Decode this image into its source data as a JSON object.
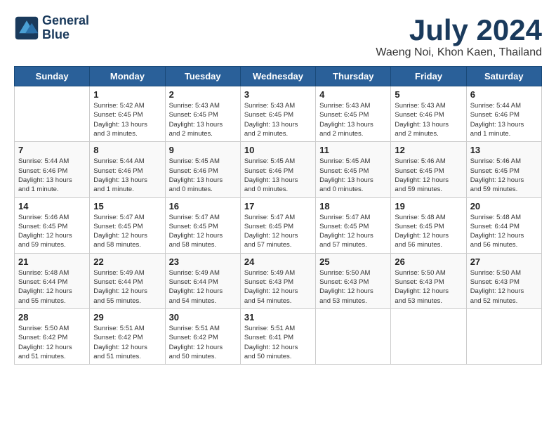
{
  "header": {
    "logo_line1": "General",
    "logo_line2": "Blue",
    "month_year": "July 2024",
    "location": "Waeng Noi, Khon Kaen, Thailand"
  },
  "weekdays": [
    "Sunday",
    "Monday",
    "Tuesday",
    "Wednesday",
    "Thursday",
    "Friday",
    "Saturday"
  ],
  "weeks": [
    [
      {
        "day": "",
        "info": ""
      },
      {
        "day": "1",
        "info": "Sunrise: 5:42 AM\nSunset: 6:45 PM\nDaylight: 13 hours\nand 3 minutes."
      },
      {
        "day": "2",
        "info": "Sunrise: 5:43 AM\nSunset: 6:45 PM\nDaylight: 13 hours\nand 2 minutes."
      },
      {
        "day": "3",
        "info": "Sunrise: 5:43 AM\nSunset: 6:45 PM\nDaylight: 13 hours\nand 2 minutes."
      },
      {
        "day": "4",
        "info": "Sunrise: 5:43 AM\nSunset: 6:45 PM\nDaylight: 13 hours\nand 2 minutes."
      },
      {
        "day": "5",
        "info": "Sunrise: 5:43 AM\nSunset: 6:46 PM\nDaylight: 13 hours\nand 2 minutes."
      },
      {
        "day": "6",
        "info": "Sunrise: 5:44 AM\nSunset: 6:46 PM\nDaylight: 13 hours\nand 1 minute."
      }
    ],
    [
      {
        "day": "7",
        "info": "Sunrise: 5:44 AM\nSunset: 6:46 PM\nDaylight: 13 hours\nand 1 minute."
      },
      {
        "day": "8",
        "info": "Sunrise: 5:44 AM\nSunset: 6:46 PM\nDaylight: 13 hours\nand 1 minute."
      },
      {
        "day": "9",
        "info": "Sunrise: 5:45 AM\nSunset: 6:46 PM\nDaylight: 13 hours\nand 0 minutes."
      },
      {
        "day": "10",
        "info": "Sunrise: 5:45 AM\nSunset: 6:46 PM\nDaylight: 13 hours\nand 0 minutes."
      },
      {
        "day": "11",
        "info": "Sunrise: 5:45 AM\nSunset: 6:45 PM\nDaylight: 13 hours\nand 0 minutes."
      },
      {
        "day": "12",
        "info": "Sunrise: 5:46 AM\nSunset: 6:45 PM\nDaylight: 12 hours\nand 59 minutes."
      },
      {
        "day": "13",
        "info": "Sunrise: 5:46 AM\nSunset: 6:45 PM\nDaylight: 12 hours\nand 59 minutes."
      }
    ],
    [
      {
        "day": "14",
        "info": "Sunrise: 5:46 AM\nSunset: 6:45 PM\nDaylight: 12 hours\nand 59 minutes."
      },
      {
        "day": "15",
        "info": "Sunrise: 5:47 AM\nSunset: 6:45 PM\nDaylight: 12 hours\nand 58 minutes."
      },
      {
        "day": "16",
        "info": "Sunrise: 5:47 AM\nSunset: 6:45 PM\nDaylight: 12 hours\nand 58 minutes."
      },
      {
        "day": "17",
        "info": "Sunrise: 5:47 AM\nSunset: 6:45 PM\nDaylight: 12 hours\nand 57 minutes."
      },
      {
        "day": "18",
        "info": "Sunrise: 5:47 AM\nSunset: 6:45 PM\nDaylight: 12 hours\nand 57 minutes."
      },
      {
        "day": "19",
        "info": "Sunrise: 5:48 AM\nSunset: 6:45 PM\nDaylight: 12 hours\nand 56 minutes."
      },
      {
        "day": "20",
        "info": "Sunrise: 5:48 AM\nSunset: 6:44 PM\nDaylight: 12 hours\nand 56 minutes."
      }
    ],
    [
      {
        "day": "21",
        "info": "Sunrise: 5:48 AM\nSunset: 6:44 PM\nDaylight: 12 hours\nand 55 minutes."
      },
      {
        "day": "22",
        "info": "Sunrise: 5:49 AM\nSunset: 6:44 PM\nDaylight: 12 hours\nand 55 minutes."
      },
      {
        "day": "23",
        "info": "Sunrise: 5:49 AM\nSunset: 6:44 PM\nDaylight: 12 hours\nand 54 minutes."
      },
      {
        "day": "24",
        "info": "Sunrise: 5:49 AM\nSunset: 6:43 PM\nDaylight: 12 hours\nand 54 minutes."
      },
      {
        "day": "25",
        "info": "Sunrise: 5:50 AM\nSunset: 6:43 PM\nDaylight: 12 hours\nand 53 minutes."
      },
      {
        "day": "26",
        "info": "Sunrise: 5:50 AM\nSunset: 6:43 PM\nDaylight: 12 hours\nand 53 minutes."
      },
      {
        "day": "27",
        "info": "Sunrise: 5:50 AM\nSunset: 6:43 PM\nDaylight: 12 hours\nand 52 minutes."
      }
    ],
    [
      {
        "day": "28",
        "info": "Sunrise: 5:50 AM\nSunset: 6:42 PM\nDaylight: 12 hours\nand 51 minutes."
      },
      {
        "day": "29",
        "info": "Sunrise: 5:51 AM\nSunset: 6:42 PM\nDaylight: 12 hours\nand 51 minutes."
      },
      {
        "day": "30",
        "info": "Sunrise: 5:51 AM\nSunset: 6:42 PM\nDaylight: 12 hours\nand 50 minutes."
      },
      {
        "day": "31",
        "info": "Sunrise: 5:51 AM\nSunset: 6:41 PM\nDaylight: 12 hours\nand 50 minutes."
      },
      {
        "day": "",
        "info": ""
      },
      {
        "day": "",
        "info": ""
      },
      {
        "day": "",
        "info": ""
      }
    ]
  ]
}
